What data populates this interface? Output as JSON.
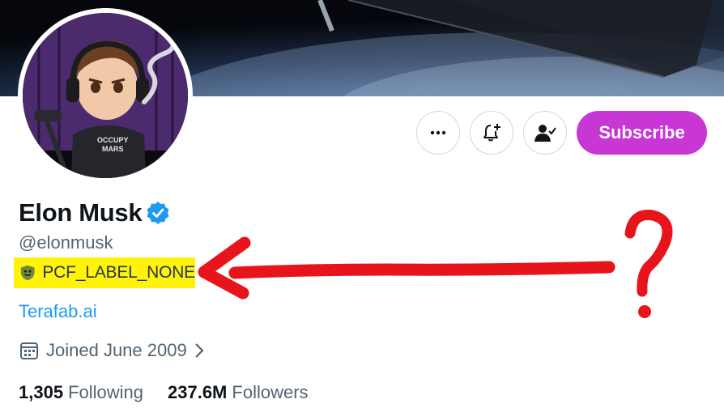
{
  "profile": {
    "display_name": "Elon Musk",
    "handle": "@elonmusk",
    "label_text": "PCF_LABEL_NONE",
    "website": "Terafab.ai",
    "joined": "Joined June 2009",
    "following_count": "1,305",
    "following_label": "Following",
    "followers_count": "237.6M",
    "followers_label": "Followers"
  },
  "actions": {
    "subscribe_label": "Subscribe",
    "subscribe_color": "#c936d6"
  },
  "avatar": {
    "shirt_text_line1": "OCCUPY",
    "shirt_text_line2": "MARS"
  },
  "annotation": {
    "mark": "?",
    "color": "#e8141c",
    "highlight_color": "#fff30a"
  },
  "icons": {
    "more": "more-dots-icon",
    "notify": "bell-plus-icon",
    "follow": "person-check-icon",
    "verified": "verified-badge-icon",
    "label": "shield-badge-icon",
    "calendar": "calendar-icon",
    "chevron": "chevron-right-icon"
  }
}
